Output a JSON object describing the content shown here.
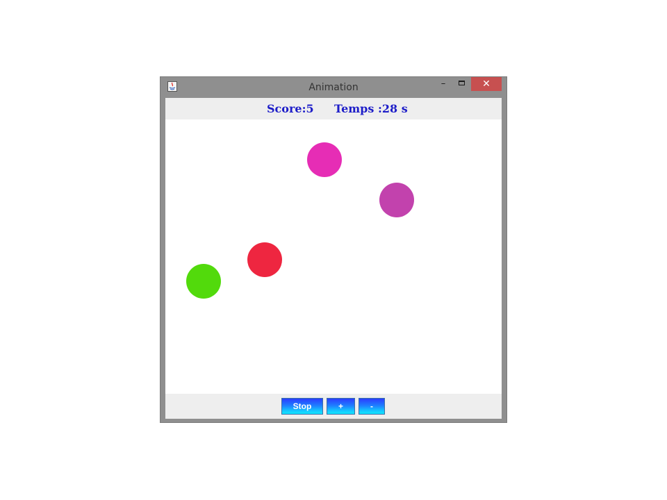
{
  "window": {
    "title": "Animation",
    "close_label": "✕",
    "minimize_label": "–"
  },
  "status": {
    "score": "Score:5",
    "time": "Temps :28 s"
  },
  "balls": [
    {
      "color": "#e62db5"
    },
    {
      "color": "#c242ad"
    },
    {
      "color": "#ee2640"
    },
    {
      "color": "#52da0c"
    }
  ],
  "controls": {
    "stop_label": "Stop",
    "plus_label": "+",
    "minus_label": "-"
  }
}
